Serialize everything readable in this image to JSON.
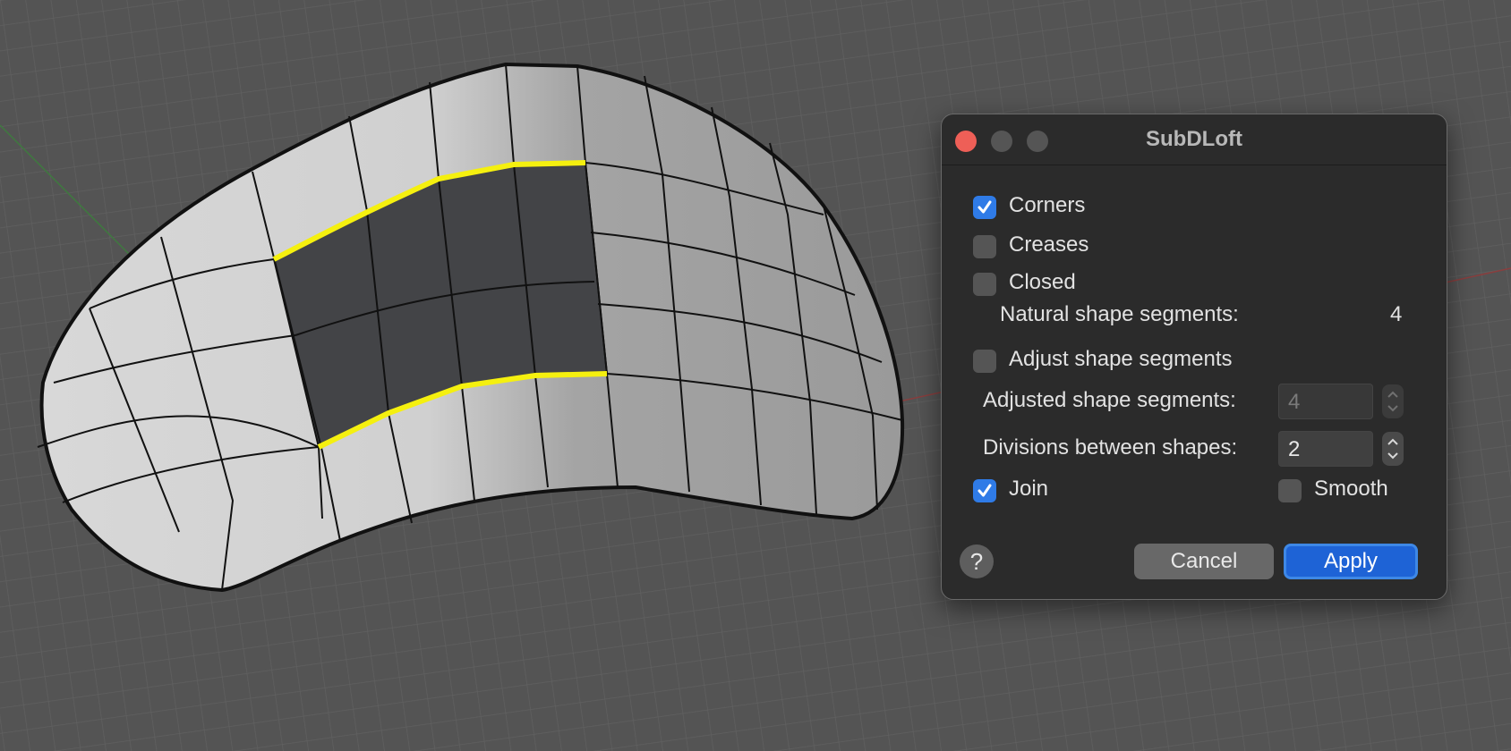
{
  "dialog": {
    "title": "SubDLoft",
    "corners": {
      "label": "Corners",
      "checked": true
    },
    "creases": {
      "label": "Creases",
      "checked": false
    },
    "closed": {
      "label": "Closed",
      "checked": false
    },
    "natural": {
      "label": "Natural shape segments:",
      "value": "4"
    },
    "adjust": {
      "label": "Adjust shape segments",
      "checked": false
    },
    "adjusted": {
      "label": "Adjusted shape segments:",
      "value": "4"
    },
    "divisions": {
      "label": "Divisions between shapes:",
      "value": "2"
    },
    "join": {
      "label": "Join",
      "checked": true
    },
    "smooth": {
      "label": "Smooth",
      "checked": false
    },
    "help": "?",
    "cancel": "Cancel",
    "apply": "Apply"
  },
  "colors": {
    "viewport": "#545454",
    "surface_light": "#d2d2d2",
    "surface_mid": "#a6a6a6",
    "surface_selected": "#434447",
    "edge_highlight": "#f5f00f",
    "accent": "#2f7be7"
  }
}
